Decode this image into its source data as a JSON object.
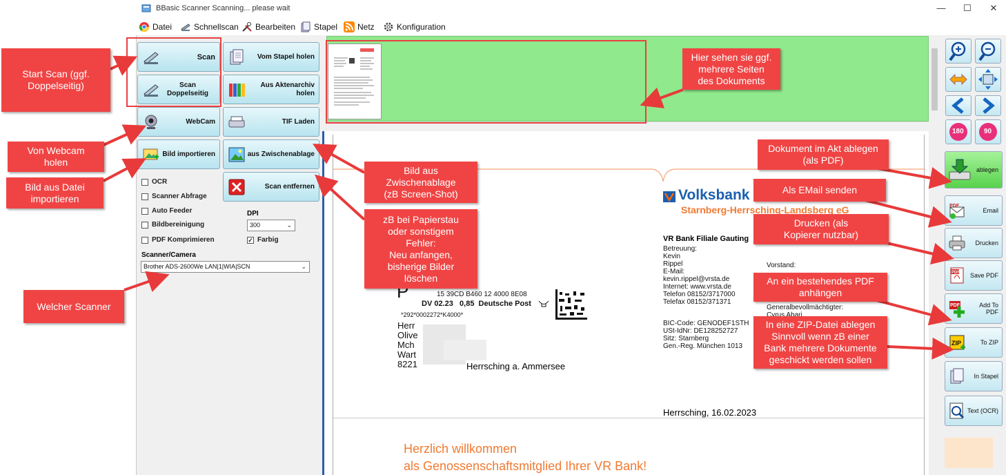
{
  "window": {
    "title": "BBasic Scanner Scanning... please wait",
    "controls": {
      "minimize": "—",
      "maximize": "☐",
      "close": "✕"
    }
  },
  "menu": [
    {
      "label": "Datei",
      "icon": "chrome-icon"
    },
    {
      "label": "Schnellscan",
      "icon": "scanner-icon"
    },
    {
      "label": "Bearbeiten",
      "icon": "tools-icon"
    },
    {
      "label": "Stapel",
      "icon": "stack-icon"
    },
    {
      "label": "Netz",
      "icon": "rss-icon"
    },
    {
      "label": "Konfiguration",
      "icon": "gear-icon"
    }
  ],
  "left_panel": {
    "buttons": {
      "scan": "Scan",
      "scan_duplex": "Scan\nDoppelseitig",
      "webcam": "WebCam",
      "image_import": "Bild importieren",
      "from_stack": "Vom Stapel holen",
      "from_archive": "Aus Aktenarchiv holen",
      "tif_load": "TIF Laden",
      "from_clipboard": "aus Zwischenablage",
      "remove_scan": "Scan entfernen"
    },
    "options": {
      "ocr": "OCR",
      "scanner_query": "Scanner Abfrage",
      "auto_feeder": "Auto Feeder",
      "image_cleanup": "Bildbereinigung",
      "pdf_compress": "PDF Komprimieren",
      "color": "Farbig",
      "color_checked": true
    },
    "dpi_label": "DPI",
    "dpi_value": "300",
    "scanner_label": "Scanner/Camera",
    "scanner_value": "Brother ADS-2600We LAN|1|WIA|SCN"
  },
  "right_toolbar": {
    "icons": [
      "zoom-in-icon",
      "zoom-out-icon",
      "fit-width-icon",
      "fit-page-icon",
      "prev-page-icon",
      "next-page-icon",
      "rotate-180-icon",
      "rotate-90-icon"
    ],
    "rotate_180": "180",
    "rotate_90": "90",
    "ablegen": "ablegen",
    "email": "Email",
    "drucken": "Drucken",
    "save_pdf": "Save PDF",
    "add_to_pdf": "Add To PDF",
    "to_zip": "To ZIP",
    "in_stapel": "In Stapel",
    "text_ocr": "Text (OCR)"
  },
  "document": {
    "bank_name": "Volksbank",
    "bank_sub": "Starnberg-Herrsching-Landsberg eG",
    "branch": "VR Bank Filiale Gauting",
    "contact": "Betreuung:\nKevin\nRippel\nE-Mail:\nkevin.rippel@vrsta.de\nInternet: www.vrsta.de\nTelefon 08152/3717000\nTelefax 08152/371371",
    "bank_ids": "BIC-Code: GENODEF1STH\nUSt-IdNr: DE128252727\nSitz: Starnberg\nGen.-Reg. München 1013",
    "board": "Vorstand:",
    "general": "Generalbevollmächtigter:\nCyrus Abari",
    "postage_code": "15 39CD B460 12 4000 8E08",
    "postage_line": "DV 02.23   0,85  Deutsche Post",
    "postage_small": "*292*0002272*K4000*",
    "postage_p": "P",
    "recipient": "Herr\nOlive\nMch\nWart\n8221",
    "recipient_city": "Herrsching a. Ammersee",
    "date_line": "Herrsching, 16.02.2023",
    "welcome1": "Herzlich willkommen",
    "welcome2": "als Genossenschaftsmitglied Ihrer VR Bank!"
  },
  "annotations": {
    "start_scan": "Start Scan (ggf.\nDoppelseitig)",
    "webcam": "Von Webcam\nholen",
    "image_file": "Bild aus Datei\nimportieren",
    "which_scanner": "Welcher Scanner",
    "pages": "Hier sehen sie ggf.\nmehrere Seiten\ndes Dokuments",
    "clipboard": "Bild aus\nZwischenablage\n(zB Screen-Shot)",
    "paper_jam": "zB bei Papierstau\noder sonstigem\nFehler:\nNeu anfangen,\nbisherige Bilder\nlöschen",
    "archive_pdf": "Dokument im Akt ablegen\n(als PDF)",
    "email": "Als EMail senden",
    "print": "Drucken (als\nKopierer nutzbar)",
    "append_pdf": "An ein bestehendes PDF\nanhängen",
    "zip": "In eine ZIP-Datei ablegen\nSinnvoll wenn zB einer\nBank mehrere Dokumente\ngeschickt werden sollen"
  }
}
